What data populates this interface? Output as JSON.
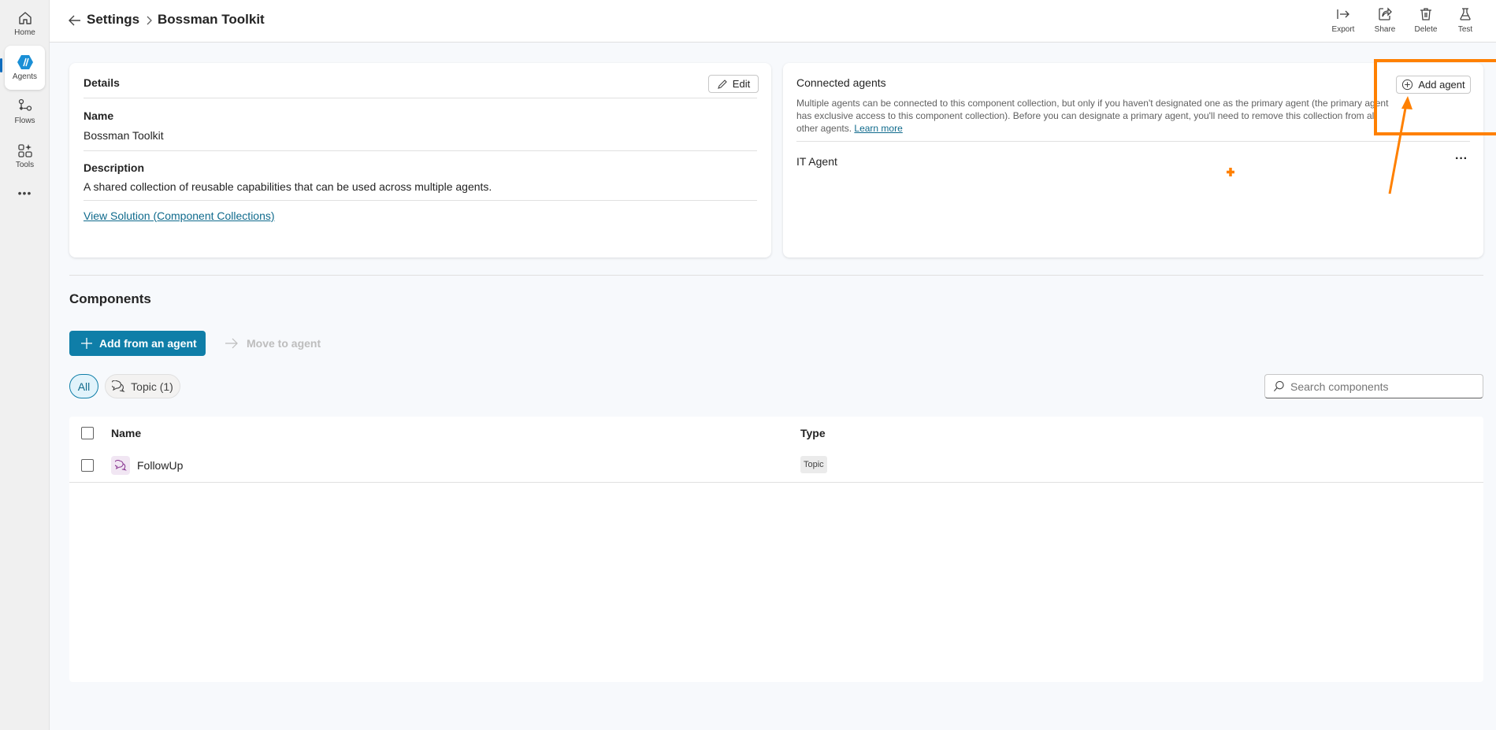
{
  "sidebar": {
    "items": [
      {
        "label": "Home",
        "icon": "home-icon"
      },
      {
        "label": "Agents",
        "icon": "agents-icon"
      },
      {
        "label": "Flows",
        "icon": "flows-icon"
      },
      {
        "label": "Tools",
        "icon": "tools-icon"
      }
    ],
    "more": "•••"
  },
  "header": {
    "breadcrumb": [
      "Settings",
      "Bossman Toolkit"
    ],
    "toolbar": [
      {
        "label": "Export",
        "icon": "export-icon"
      },
      {
        "label": "Share",
        "icon": "share-icon"
      },
      {
        "label": "Delete",
        "icon": "delete-icon"
      },
      {
        "label": "Test",
        "icon": "test-flask-icon"
      }
    ]
  },
  "details": {
    "title": "Details",
    "edit_label": "Edit",
    "name_label": "Name",
    "name_value": "Bossman Toolkit",
    "description_label": "Description",
    "description_value": "A shared collection of reusable capabilities that can be used across multiple agents.",
    "solution_link": "View Solution (Component Collections)"
  },
  "connected": {
    "title": "Connected agents",
    "add_label": "Add agent",
    "description": "Multiple agents can be connected to this component collection, but only if you haven't designated one as the primary agent (the primary agent has exclusive access to this component collection). Before you can designate a primary agent, you'll need to remove this collection from all other agents.",
    "learn_more": "Learn more",
    "agents": [
      {
        "name": "IT Agent",
        "more": "···"
      }
    ]
  },
  "components": {
    "title": "Components",
    "add_button": "Add from an agent",
    "move_button": "Move to agent",
    "filters": [
      {
        "label": "All",
        "selected": true
      },
      {
        "label": "Topic (1)",
        "selected": false
      }
    ],
    "search_placeholder": "Search components",
    "columns": [
      "Name",
      "Type"
    ],
    "rows": [
      {
        "name": "FollowUp",
        "type": "Topic"
      }
    ]
  },
  "colors": {
    "accent": "#0f7ea8",
    "annotation": "#ff8000",
    "link": "#0f6a8c"
  }
}
